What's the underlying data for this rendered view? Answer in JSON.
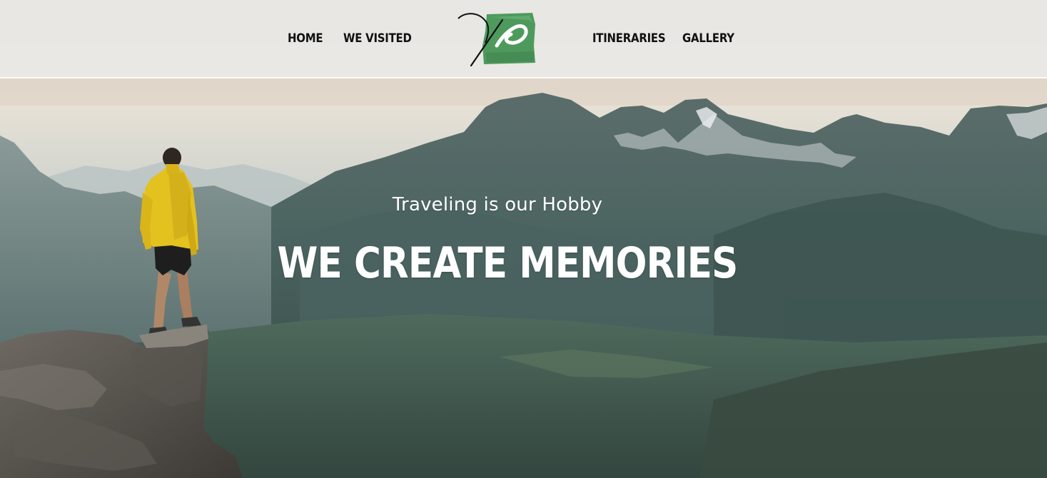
{
  "nav": {
    "left_items": [
      {
        "label": "HOME"
      },
      {
        "label": "WE VISITED"
      }
    ],
    "right_items": [
      {
        "label": "ITINERARIES"
      },
      {
        "label": "GALLERY"
      }
    ]
  },
  "logo": {
    "icon": "brush-stroke-heart-logo",
    "accent_color": "#4e9a5d"
  },
  "hero": {
    "tagline": "Traveling is our Hobby",
    "headline": "WE CREATE MEMORIES",
    "background_image": "hiker-on-mountain-ridge-photo"
  },
  "colors": {
    "nav_text": "#111111",
    "hero_text": "#ffffff",
    "header_bg": "#ebebe8"
  }
}
